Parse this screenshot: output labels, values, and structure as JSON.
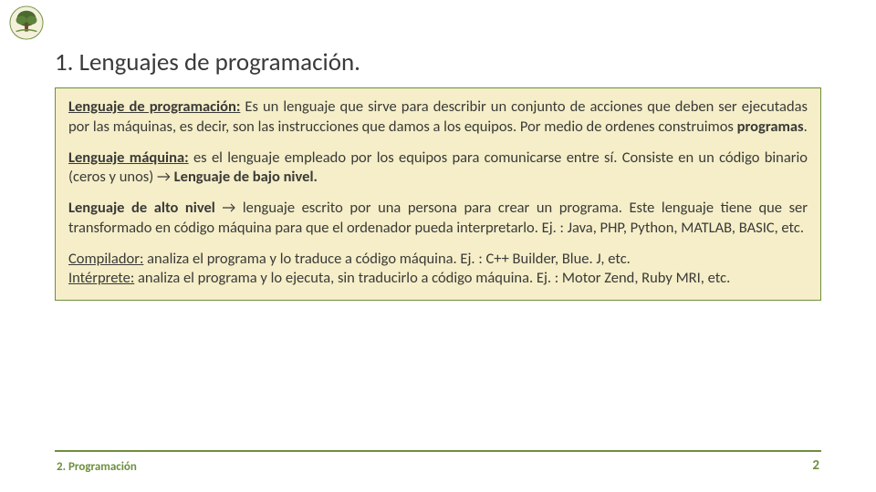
{
  "title": "1. Lenguajes de programación.",
  "paragraphs": [
    {
      "lead": "Lenguaje de programación:",
      "lead_style": "ub",
      "body_pre": " Es un lenguaje que sirve para describir un conjunto de acciones que deben ser ejecutadas por las máquinas, es decir, son las instrucciones que damos a los equipos. Por medio de ordenes construimos ",
      "bold_tail": "programas",
      "body_post": "."
    },
    {
      "lead": "Lenguaje máquina:",
      "lead_style": "ub",
      "body_pre": " es el lenguaje empleado por los equipos para comunicarse entre sí. Consiste en un código binario (ceros y unos) → ",
      "bold_tail": "Lenguaje de bajo nivel.",
      "body_post": ""
    },
    {
      "lead": "Lenguaje de alto nivel",
      "lead_style": "b",
      "body_pre": " → lenguaje escrito por una persona para crear un programa. Este lenguaje tiene que ser transformado en código máquina para que el ordenador pueda interpretarlo. Ej. : Java, PHP, Python, MATLAB, BASIC, etc.",
      "bold_tail": "",
      "body_post": ""
    },
    {
      "lead": "Compilador:",
      "lead_style": "u",
      "body_pre": " analiza el programa y lo traduce a código máquina. Ej. : C++ Builder, Blue. J, etc.",
      "lead2": "Intérprete:",
      "body_pre2": " analiza el programa y lo ejecuta, sin traducirlo a código máquina. Ej. : Motor Zend, Ruby MRI, etc."
    }
  ],
  "footer": {
    "left": "2. Programación",
    "right": "2"
  },
  "colors": {
    "accent": "#6d8f3e",
    "box_bg": "#f5eec8",
    "text": "#3a3a38"
  }
}
